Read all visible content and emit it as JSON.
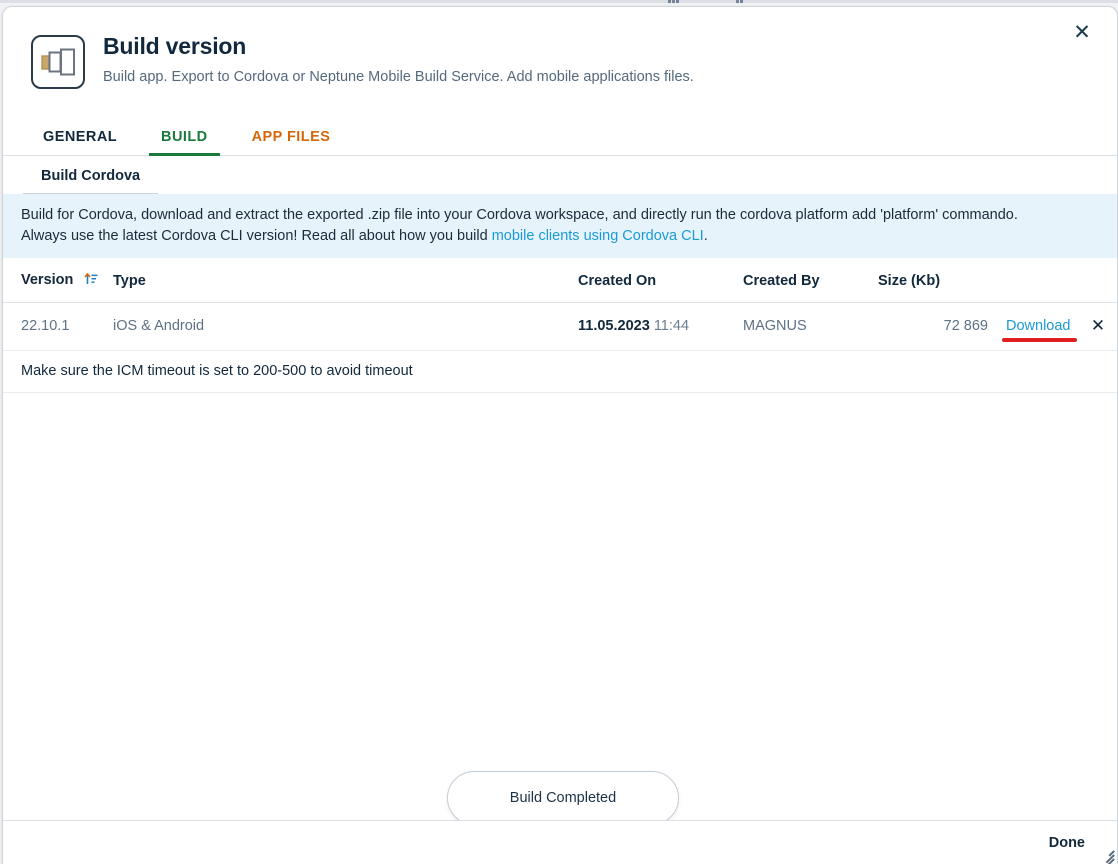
{
  "dialog": {
    "title": "Build version",
    "subtitle": "Build app. Export to Cordova or Neptune Mobile Build Service. Add mobile applications files.",
    "app_icon": "mobile-apps-icon",
    "close_label": "✕"
  },
  "tabs": [
    {
      "label": "GENERAL",
      "name": "tab-general",
      "state": "inactive"
    },
    {
      "label": "BUILD",
      "name": "tab-build",
      "state": "active",
      "color": "#1a7a3c"
    },
    {
      "label": "APP FILES",
      "name": "tab-app-files",
      "state": "inactive",
      "color": "#d4670a"
    }
  ],
  "subtabs": [
    {
      "label": "Build Cordova",
      "name": "subtab-build-cordova",
      "state": "active"
    }
  ],
  "banner": {
    "line1_part1": "Build for Cordova, download and extract the exported .zip file into your Cordova workspace, and directly run the cordova platform add 'platform' commando.",
    "line2_part1": "Always use the latest Cordova CLI version! Read all about how you build ",
    "link_text": "mobile clients using Cordova CLI",
    "line2_part2": ".",
    "background": "#e7f3fb",
    "link_color": "#1b9ad4"
  },
  "table": {
    "columns": [
      {
        "label": "Version",
        "name": "col-version",
        "sort": "ascending"
      },
      {
        "label": "Type",
        "name": "col-type"
      },
      {
        "label": "Created On",
        "name": "col-created-on"
      },
      {
        "label": "Created By",
        "name": "col-created-by"
      },
      {
        "label": "Size (Kb)",
        "name": "col-size"
      },
      {
        "label": "",
        "name": "col-download"
      },
      {
        "label": "",
        "name": "col-delete"
      }
    ],
    "rows": [
      {
        "version": "22.10.1",
        "type": "iOS & Android",
        "created_date": "11.05.2023",
        "created_time": "11:44",
        "created_by": "MAGNUS",
        "size": "72 869",
        "download_label": "Download",
        "delete_label": "✕",
        "download_highlight_color": "#e02020"
      }
    ]
  },
  "note": "Make sure the ICM timeout is set to 200-500 to avoid timeout",
  "toast": {
    "message": "Build Completed"
  },
  "footer": {
    "done_label": "Done",
    "resize_handle": "resize-grip-icon"
  }
}
